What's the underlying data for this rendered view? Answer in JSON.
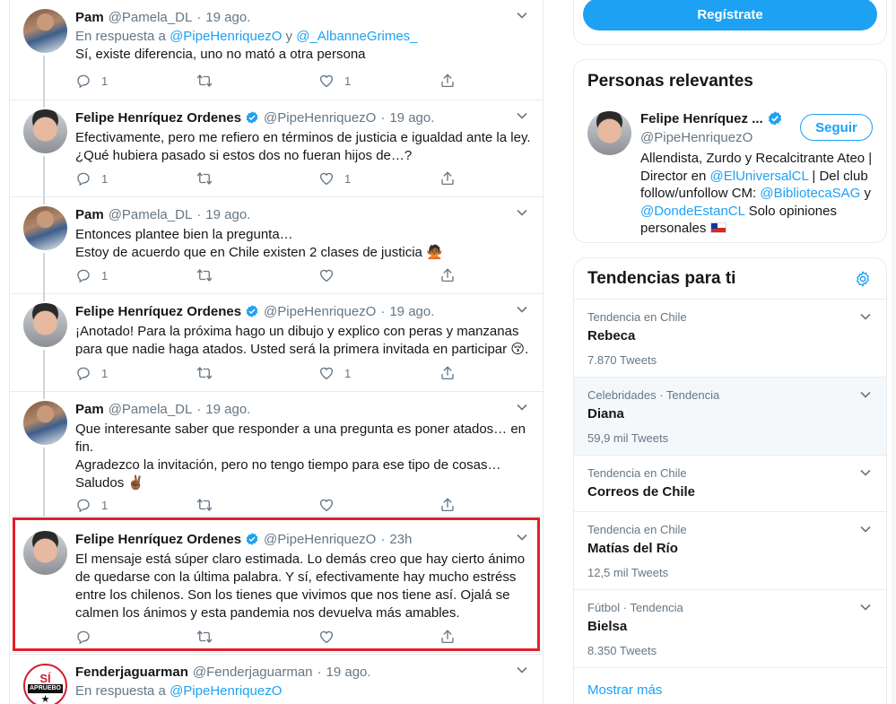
{
  "timeline": {
    "tweets": [
      {
        "author": "Pam",
        "handle": "@Pamela_DL",
        "dot": "·",
        "time": "19 ago.",
        "verified": false,
        "avatar": "pam",
        "reply_prefix": "En respuesta a",
        "reply_handles": [
          "@PipeHenriquezO",
          "y",
          "@_AlbanneGrimes_"
        ],
        "lines": [
          "Sí, existe diferencia, uno no mató a otra persona"
        ],
        "reply_count": "1",
        "retweet_count": "",
        "like_count": "1"
      },
      {
        "author": "Felipe Henríquez Ordenes",
        "handle": "@PipeHenriquezO",
        "dot": "·",
        "time": "19 ago.",
        "verified": true,
        "avatar": "felipe",
        "lines": [
          "Efectivamente, pero me refiero en términos de justicia e igualdad ante la ley.",
          "¿Qué hubiera pasado si estos dos no fueran hijos de…?"
        ],
        "reply_count": "1",
        "retweet_count": "",
        "like_count": "1"
      },
      {
        "author": "Pam",
        "handle": "@Pamela_DL",
        "dot": "·",
        "time": "19 ago.",
        "verified": false,
        "avatar": "pam",
        "lines": [
          "Entonces plantee bien la pregunta…",
          "Estoy de acuerdo que en Chile existen 2 clases de justicia"
        ],
        "emoji": "🙅🏾",
        "reply_count": "1",
        "retweet_count": "",
        "like_count": ""
      },
      {
        "author": "Felipe Henríquez Ordenes",
        "handle": "@PipeHenriquezO",
        "dot": "·",
        "time": "19 ago.",
        "verified": true,
        "avatar": "felipe",
        "lines": [
          "¡Anotado! Para la próxima hago un dibujo y explico con peras y manzanas",
          "para que nadie haga atados. Usted será la primera invitada en participar"
        ],
        "emoji": "😚.",
        "reply_count": "1",
        "retweet_count": "",
        "like_count": "1"
      },
      {
        "author": "Pam",
        "handle": "@Pamela_DL",
        "dot": "·",
        "time": "19 ago.",
        "verified": false,
        "avatar": "pam",
        "lines": [
          "Que interesante saber que responder a una pregunta es poner atados… en",
          "fin.",
          "Agradezco la invitación, pero no tengo tiempo para ese tipo de cosas…",
          "Saludos"
        ],
        "emoji": "✌🏾",
        "reply_count": "1",
        "retweet_count": "",
        "like_count": ""
      },
      {
        "author": "Felipe Henríquez Ordenes",
        "handle": "@PipeHenriquezO",
        "dot": "·",
        "time": "23h",
        "verified": true,
        "avatar": "felipe",
        "lines": [
          "El mensaje está súper claro estimada. Lo demás creo que hay cierto ánimo",
          "de quedarse con la última palabra. Y sí, efectivamente hay mucho estréss",
          "entre los chilenos. Son los tienes que vivimos que nos tiene así. Ojalá se",
          "calmen los ánimos y esta pandemia nos devuelva más amables."
        ],
        "reply_count": "",
        "retweet_count": "",
        "like_count": ""
      },
      {
        "author": "Fenderjaguarman",
        "handle": "@Fenderjaguarman",
        "dot": "·",
        "time": "19 ago.",
        "verified": false,
        "avatar": "fender",
        "reply_prefix": "En respuesta a",
        "reply_handles": [
          "@PipeHenriquezO"
        ],
        "lines": []
      }
    ],
    "fender_avatar_text": {
      "si": "SÍ",
      "apruebo": "APRUEBO"
    }
  },
  "sidebar": {
    "signup_label": "Regístrate",
    "people": {
      "title": "Personas relevantes",
      "name": "Felipe Henríquez ...",
      "handle": "@PipeHenriquezO",
      "follow_label": "Seguir",
      "bio_parts": [
        "Allendista, Zurdo y Recalcitrante Ateo | Director en ",
        "@ElUniversalCL",
        " | Del club follow/unfollow CM: ",
        "@BibliotecaSAG",
        " y ",
        "@DondeEstanCL",
        " Solo opiniones personales "
      ]
    },
    "trends": {
      "title": "Tendencias para ti",
      "items": [
        {
          "meta": "Tendencia en Chile",
          "name": "Rebeca",
          "count": "7.870 Tweets"
        },
        {
          "meta": "Celebridades · Tendencia",
          "name": "Diana",
          "count": "59,9 mil Tweets"
        },
        {
          "meta": "Tendencia en Chile",
          "name": "Correos de Chile",
          "count": ""
        },
        {
          "meta": "Tendencia en Chile",
          "name": "Matías del Río",
          "count": "12,5 mil Tweets"
        },
        {
          "meta": "Fútbol · Tendencia",
          "name": "Bielsa",
          "count": "8.350 Tweets"
        }
      ],
      "show_more": "Mostrar más"
    }
  },
  "colors": {
    "accent": "#1da1f2",
    "highlight": "#e0202a",
    "text": "#14171a",
    "muted": "#657786"
  }
}
